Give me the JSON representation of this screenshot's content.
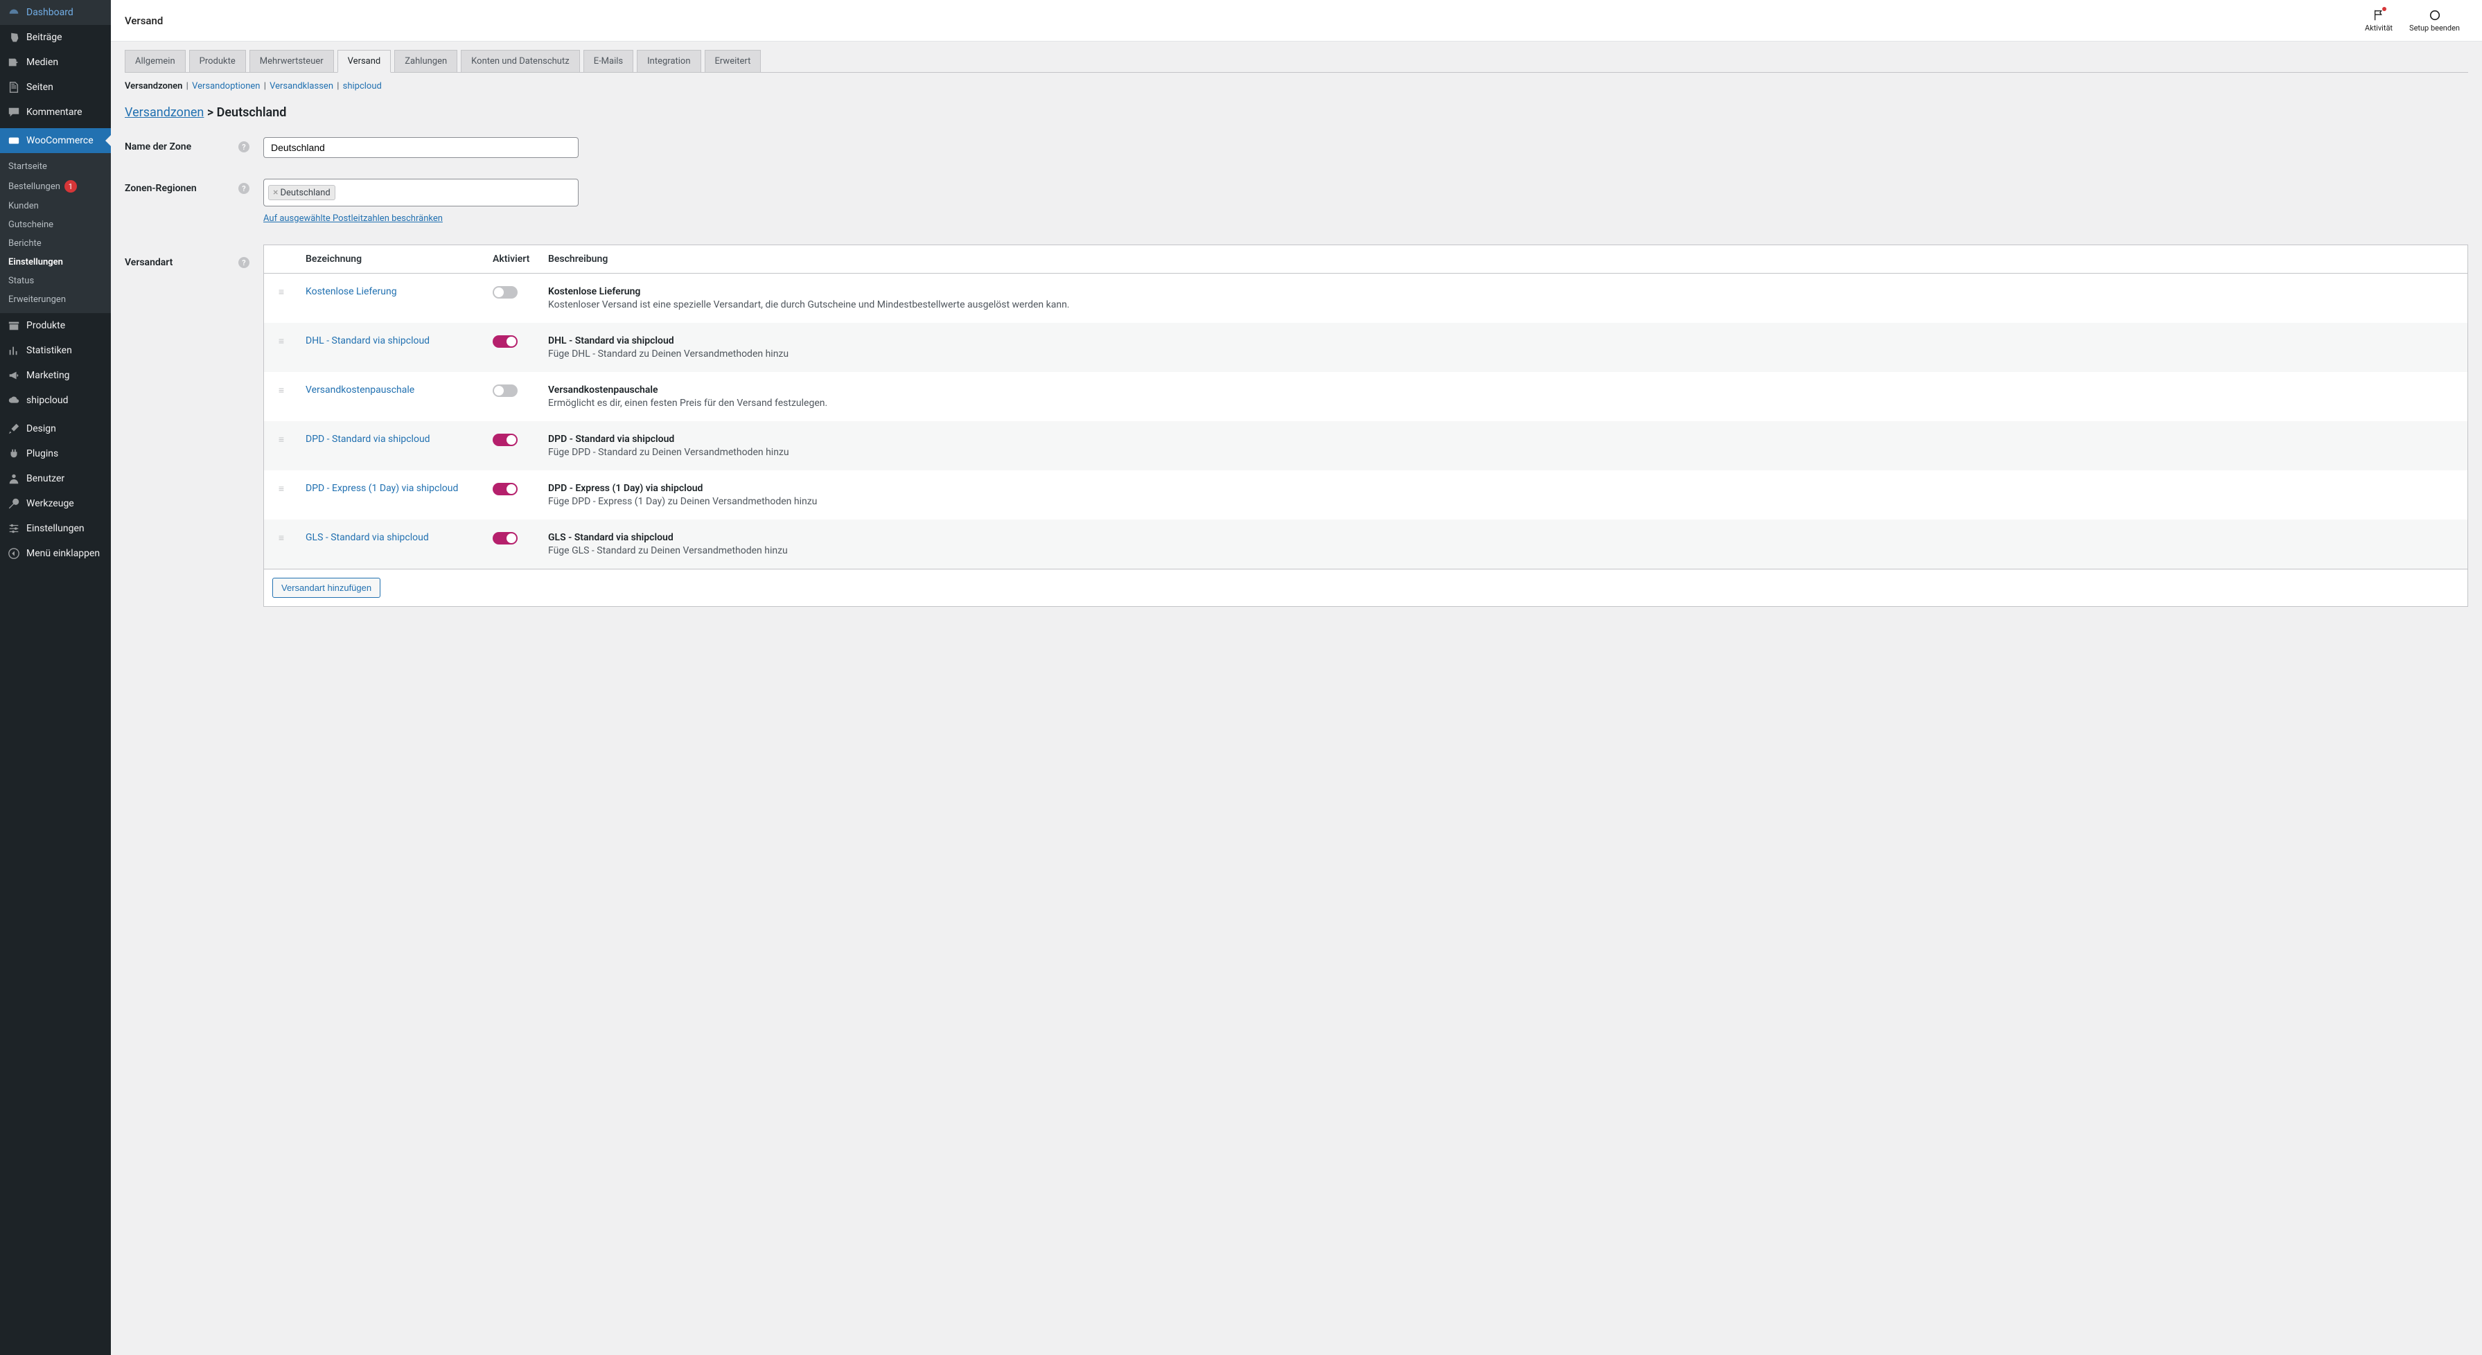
{
  "sidebar": {
    "items": [
      {
        "label": "Dashboard",
        "icon": "dashboard"
      },
      {
        "label": "Beiträge",
        "icon": "pin"
      },
      {
        "label": "Medien",
        "icon": "media"
      },
      {
        "label": "Seiten",
        "icon": "page"
      },
      {
        "label": "Kommentare",
        "icon": "comment"
      }
    ],
    "woo": {
      "label": "WooCommerce"
    },
    "woo_sub": [
      {
        "label": "Startseite"
      },
      {
        "label": "Bestellungen",
        "badge": "1"
      },
      {
        "label": "Kunden"
      },
      {
        "label": "Gutscheine"
      },
      {
        "label": "Berichte"
      },
      {
        "label": "Einstellungen",
        "active": true
      },
      {
        "label": "Status"
      },
      {
        "label": "Erweiterungen"
      }
    ],
    "lower": [
      {
        "label": "Produkte",
        "icon": "archive"
      },
      {
        "label": "Statistiken",
        "icon": "stats"
      },
      {
        "label": "Marketing",
        "icon": "megaphone"
      },
      {
        "label": "shipcloud",
        "icon": "cloud"
      }
    ],
    "lower2": [
      {
        "label": "Design",
        "icon": "brush"
      },
      {
        "label": "Plugins",
        "icon": "plugin"
      },
      {
        "label": "Benutzer",
        "icon": "user"
      },
      {
        "label": "Werkzeuge",
        "icon": "wrench"
      },
      {
        "label": "Einstellungen",
        "icon": "sliders"
      },
      {
        "label": "Menü einklappen",
        "icon": "collapse"
      }
    ]
  },
  "topbar": {
    "title": "Versand",
    "activity": "Aktivität",
    "setup": "Setup beenden"
  },
  "tabs": [
    {
      "label": "Allgemein"
    },
    {
      "label": "Produkte"
    },
    {
      "label": "Mehrwertsteuer"
    },
    {
      "label": "Versand",
      "active": true
    },
    {
      "label": "Zahlungen"
    },
    {
      "label": "Konten und Datenschutz"
    },
    {
      "label": "E-Mails"
    },
    {
      "label": "Integration"
    },
    {
      "label": "Erweitert"
    }
  ],
  "sublinks": {
    "current": "Versandzonen",
    "items": [
      "Versandoptionen",
      "Versandklassen",
      "shipcloud"
    ]
  },
  "breadcrumb": {
    "root": "Versandzonen",
    "sep": ">",
    "current": "Deutschland"
  },
  "form": {
    "zone_name_label": "Name der Zone",
    "zone_name_value": "Deutschland",
    "zone_regions_label": "Zonen-Regionen",
    "zone_region_tag": "Deutschland",
    "limit_link": "Auf ausgewählte Postleitzahlen beschränken",
    "shipping_method_label": "Versandart"
  },
  "table": {
    "headers": {
      "title": "Bezeichnung",
      "enabled": "Aktiviert",
      "desc": "Beschreibung"
    },
    "rows": [
      {
        "name": "Kostenlose Lieferung",
        "enabled": false,
        "desc_title": "Kostenlose Lieferung",
        "desc_text": "Kostenloser Versand ist eine spezielle Versandart, die durch Gutscheine und Mindestbestellwerte ausgelöst werden kann."
      },
      {
        "name": "DHL - Standard via shipcloud",
        "enabled": true,
        "desc_title": "DHL - Standard via shipcloud",
        "desc_text": "Füge DHL - Standard zu Deinen Versandmethoden hinzu",
        "alt": true
      },
      {
        "name": "Versandkostenpauschale",
        "enabled": false,
        "desc_title": "Versandkostenpauschale",
        "desc_text": "Ermöglicht es dir, einen festen Preis für den Versand festzulegen."
      },
      {
        "name": "DPD - Standard via shipcloud",
        "enabled": true,
        "desc_title": "DPD - Standard via shipcloud",
        "desc_text": "Füge DPD - Standard zu Deinen Versandmethoden hinzu",
        "alt": true
      },
      {
        "name": "DPD - Express (1 Day) via shipcloud",
        "enabled": true,
        "desc_title": "DPD - Express (1 Day) via shipcloud",
        "desc_text": "Füge DPD - Express (1 Day) zu Deinen Versandmethoden hinzu"
      },
      {
        "name": "GLS - Standard via shipcloud",
        "enabled": true,
        "desc_title": "GLS - Standard via shipcloud",
        "desc_text": "Füge GLS - Standard zu Deinen Versandmethoden hinzu",
        "alt": true
      }
    ],
    "add_button": "Versandart hinzufügen"
  }
}
